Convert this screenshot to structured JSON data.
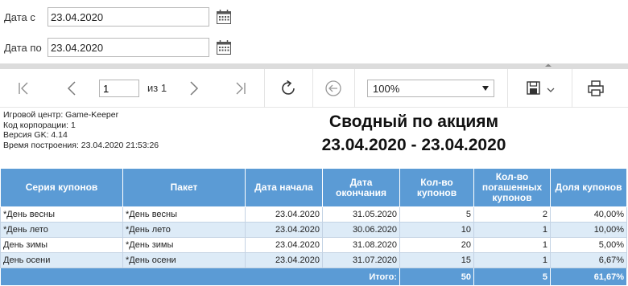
{
  "filters": {
    "date_from_label": "Дата с",
    "date_from_value": "23.04.2020",
    "date_to_label": "Дата по",
    "date_to_value": "23.04.2020"
  },
  "toolbar": {
    "page_value": "1",
    "page_of": "из 1",
    "zoom": "100%"
  },
  "report": {
    "meta": [
      "Игровой центр: Game-Keeper",
      "Код корпорации: 1",
      "Версия GK: 4.14",
      "Время построения: 23.04.2020 21:53:26"
    ],
    "title_line1": "Сводный по акциям",
    "title_line2": "23.04.2020 - 23.04.2020",
    "columns": [
      "Серия купонов",
      "Пакет",
      "Дата начала",
      "Дата окончания",
      "Кол-во купонов",
      "Кол-во погашенных купонов",
      "Доля купонов"
    ],
    "rows": [
      [
        "*День весны",
        "*День весны",
        "23.04.2020",
        "31.05.2020",
        "5",
        "2",
        "40,00%"
      ],
      [
        "*День лето",
        "*День лето",
        "23.04.2020",
        "30.06.2020",
        "10",
        "1",
        "10,00%"
      ],
      [
        "День зимы",
        "*День зимы",
        "23.04.2020",
        "31.08.2020",
        "20",
        "1",
        "5,00%"
      ],
      [
        "День осени",
        "*День осени",
        "23.04.2020",
        "31.07.2020",
        "15",
        "1",
        "6,67%"
      ]
    ],
    "total": {
      "label": "Итого:",
      "count": "50",
      "redeemed": "5",
      "share": "61,67%"
    }
  }
}
